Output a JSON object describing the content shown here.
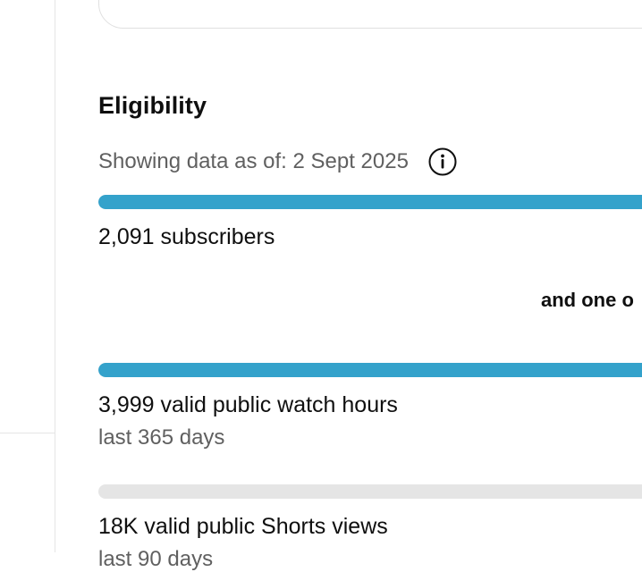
{
  "eligibility": {
    "title": "Eligibility",
    "as_of_text": "Showing data as of: 2 Sept 2025",
    "info_icon": "info-icon",
    "connector_text": "and one o",
    "accent_color": "#34a2cb",
    "track_color": "#e5e5e5",
    "metrics": [
      {
        "primary": "2,091 subscribers",
        "secondary": "",
        "progress": 1.0
      },
      {
        "primary": "3,999 valid public watch hours",
        "secondary": "last 365 days",
        "progress": 1.0
      },
      {
        "primary": "18K valid public Shorts views",
        "secondary": "last 90 days",
        "progress": 0.0
      }
    ]
  }
}
